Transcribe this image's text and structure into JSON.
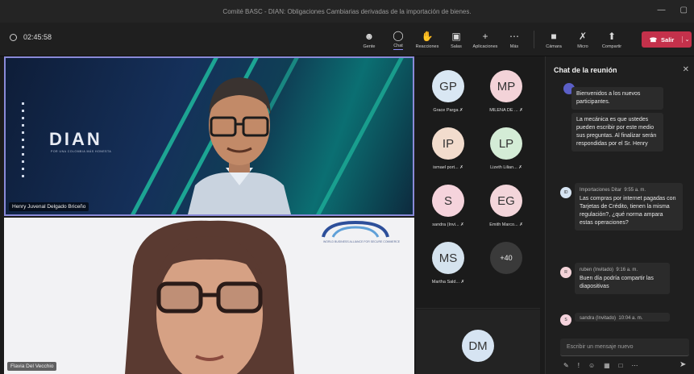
{
  "window": {
    "title": "Comité BASC - DIAN: Obligaciones Cambiarias derivadas de la importación de bienes."
  },
  "toolbar": {
    "timer": "02:45:58",
    "tools": [
      {
        "label": "Gente",
        "icon": "people-icon"
      },
      {
        "label": "Chat",
        "icon": "chat-icon"
      },
      {
        "label": "Reacciones",
        "icon": "reactions-icon"
      },
      {
        "label": "Salas",
        "icon": "rooms-icon"
      },
      {
        "label": "Aplicaciones",
        "icon": "apps-icon"
      },
      {
        "label": "Más",
        "icon": "more-icon"
      }
    ],
    "devices": [
      {
        "label": "Cámara",
        "icon": "camera-icon"
      },
      {
        "label": "Micro",
        "icon": "mic-off-icon"
      },
      {
        "label": "Compartir",
        "icon": "share-icon"
      }
    ],
    "leave_label": "Salir"
  },
  "stage": {
    "speaker_name": "Henry Juvenal Delgado Briceño",
    "dian_logo": "DIAN",
    "dian_tagline": "POR UNA COLOMBIA MÁS HONESTA",
    "second_name": "Flavia Del Vecchio",
    "basc_caption": "WORLD BUSINESS ALLIANCE FOR SECURE COMMERCE"
  },
  "gallery": {
    "participants": [
      {
        "initials": "GP",
        "name": "Grace Parga",
        "color": "#d9e7f3"
      },
      {
        "initials": "MP",
        "name": "MILENA DE ...",
        "color": "#f3d3d8"
      },
      {
        "initials": "IP",
        "name": "ismael port...",
        "color": "#f2dccd"
      },
      {
        "initials": "LP",
        "name": "Lizeth Lilian...",
        "color": "#d4ecd6"
      },
      {
        "initials": "S",
        "name": "sandra (Invi...",
        "color": "#f5d3dc"
      },
      {
        "initials": "EG",
        "name": "Emith Marco...",
        "color": "#f3d5da"
      },
      {
        "initials": "MS",
        "name": "Martha Sald...",
        "color": "#d5e3ee"
      }
    ],
    "overflow_count": "+40",
    "dm_initials": "DM",
    "dm_color": "#d6e4f2"
  },
  "chat": {
    "title": "Chat de la reunión",
    "messages": [
      {
        "text": "Bienvenidos a los nuevos participantes."
      },
      {
        "text": "La mecánica es que ustedes pueden escribir por este medio sus preguntas. Al finalizar serán respondidas por el Sr. Henry"
      },
      {
        "author": "Importaciones Ditar",
        "time": "9:55 a. m.",
        "avatar": "ID",
        "text": "Las compras por internet pagadas con Tarjetas de Crédito, tienen la misma regulación?, ¿qué norma ampara estas operaciones?"
      },
      {
        "author": "ruben (Invitado)",
        "time": "9:16 a. m.",
        "avatar": "R",
        "text": "Buen día podría compartir las diapositivas"
      },
      {
        "author": "sandra (Invitado)",
        "time": "10:04 a. m.",
        "avatar": "S"
      }
    ],
    "compose_placeholder": "Escribir un mensaje nuevo"
  }
}
